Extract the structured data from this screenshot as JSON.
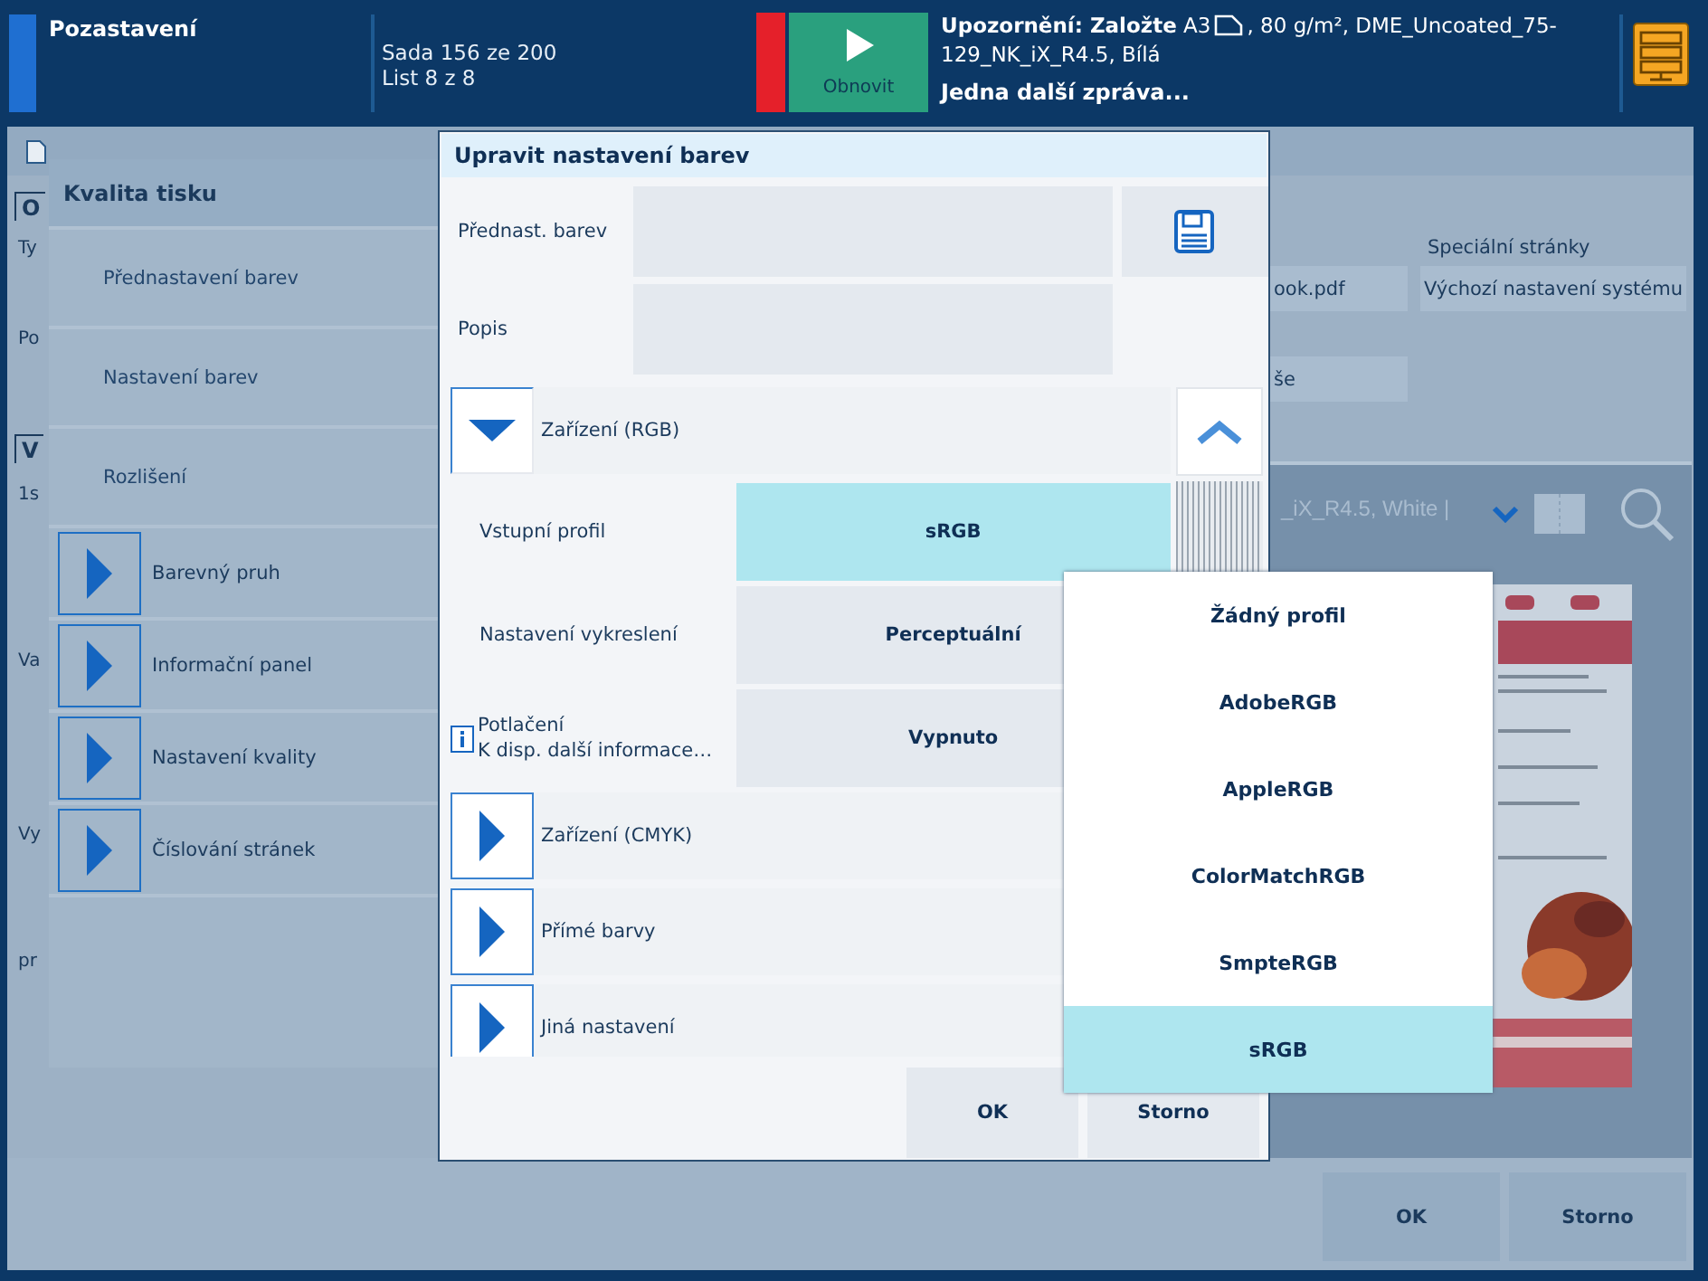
{
  "status_bar": {
    "title": "Pozastavení",
    "set_count": "Sada 156 ze 200",
    "sheet_count": "List 8 z 8",
    "resume_button": "Obnovit",
    "warning_start": "**Upozornění: Založte** A3",
    "warning_end": ", 80 g/m², DME_Uncoated_75-",
    "warning_line_2": "129_NK_iX_R4.5, Bílá",
    "more_messages": "Jedna další zpráva..."
  },
  "background_window": {
    "fragments": [
      {
        "kind": "tab",
        "text": "O"
      },
      {
        "kind": "label",
        "text": "Ty"
      },
      {
        "kind": "label",
        "text": "Po"
      },
      {
        "kind": "tab",
        "text": "V"
      },
      {
        "kind": "label",
        "text": "1s"
      },
      {
        "kind": "label",
        "text": "Va"
      },
      {
        "kind": "label",
        "text": "Vy"
      },
      {
        "kind": "label",
        "text": "pr"
      }
    ],
    "special_pages_label": "Speciální stránky",
    "file_button": "ook.pdf",
    "special_pages_button": "Výchozí nastavení systému",
    "button_3": "še",
    "media_text": "_iX_R4.5, White |",
    "buttons": [
      "OK",
      "Storno"
    ]
  },
  "quality_panel": {
    "title": "Kvalita tisku",
    "items": [
      {
        "kind": "plain",
        "label": "Přednastavení barev"
      },
      {
        "kind": "plain",
        "label": "Nastavení barev"
      },
      {
        "kind": "plain",
        "label": "Rozlišení"
      },
      {
        "kind": "expander",
        "label": "Barevný pruh",
        "expanded": false
      },
      {
        "kind": "expander",
        "label": "Informační panel",
        "expanded": false
      },
      {
        "kind": "expander",
        "label": "Nastavení kvality",
        "expanded": false
      },
      {
        "kind": "expander",
        "label": "Číslování stránek",
        "expanded": false
      }
    ]
  },
  "dialog": {
    "title": "Upravit nastavení barev",
    "preset_label": "Přednast. barev",
    "description_label": "Popis",
    "sections": [
      {
        "label": "Zařízení (RGB)",
        "expanded": true,
        "settings": [
          {
            "label": "Vstupní profil",
            "value": "sRGB",
            "selected": true
          },
          {
            "label": "Nastavení vykreslení",
            "value": "Perceptuální",
            "selected": false
          },
          {
            "label": "Potlačení",
            "note": "K disp. další informace…",
            "value": "Vypnuto",
            "selected": false
          }
        ]
      },
      {
        "label": "Zařízení (CMYK)",
        "expanded": false
      },
      {
        "label": "Přímé barvy",
        "expanded": false
      },
      {
        "label": "Jiná nastavení",
        "expanded": false
      }
    ],
    "buttons": [
      "OK",
      "Storno"
    ]
  },
  "dropdown": {
    "options": [
      {
        "label": "Žádný profil",
        "selected": false
      },
      {
        "label": "AdobeRGB",
        "selected": false
      },
      {
        "label": "AppleRGB",
        "selected": false
      },
      {
        "label": "ColorMatchRGB",
        "selected": false
      },
      {
        "label": "SmpteRGB",
        "selected": false
      },
      {
        "label": "sRGB",
        "selected": true
      }
    ]
  }
}
